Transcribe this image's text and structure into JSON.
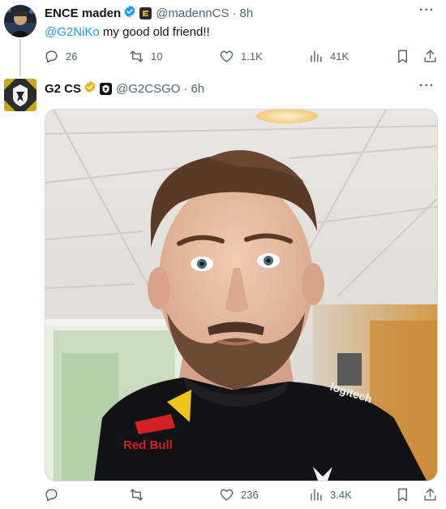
{
  "tweet1": {
    "author_name": "ENCE maden",
    "handle": "@madennCS",
    "time": "8h",
    "mention": "@G2NiKo",
    "text": " my good old friend!!",
    "replies": "26",
    "retweets": "10",
    "likes": "1.1K",
    "views": "41K"
  },
  "tweet2": {
    "author_name": "G2 CS",
    "handle": "@G2CSGO",
    "time": "6h",
    "media_logo_text": "logitech",
    "media_sponsor_text": "Red Bull",
    "replies": "",
    "retweets": "",
    "likes": "236",
    "views": "3.4K"
  },
  "colors": {
    "verified_blue": "#1d9bf0",
    "verified_gold": "#e2b719",
    "mention": "#1d9bf0",
    "secondary_text": "#536471"
  },
  "icons": [
    "more-icon",
    "reply-icon",
    "retweet-icon",
    "like-icon",
    "views-icon",
    "bookmark-icon",
    "share-icon",
    "verified-badge-icon"
  ]
}
